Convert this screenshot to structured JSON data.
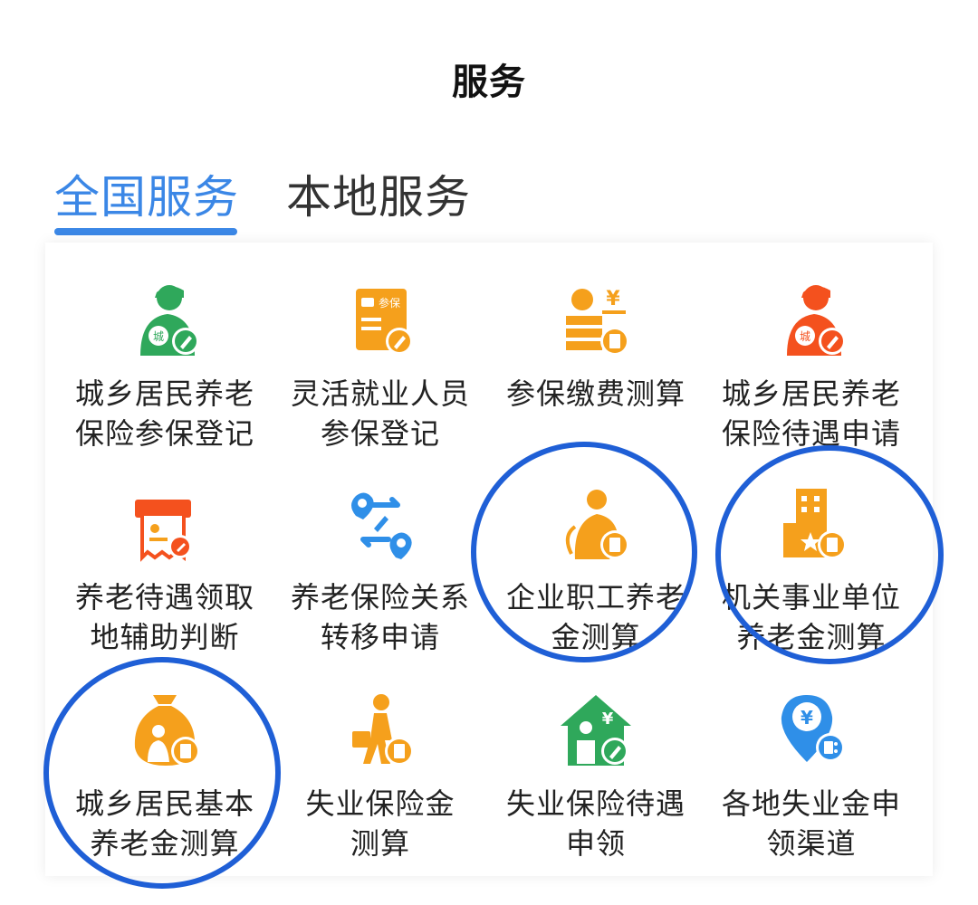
{
  "header": {
    "title": "服务"
  },
  "tabs": [
    {
      "label": "全国服务",
      "active": true
    },
    {
      "label": "本地服务",
      "active": false
    }
  ],
  "colors": {
    "accent": "#3b87e6",
    "highlight_circle": "#1f5fd6",
    "green": "#2fa85b",
    "orange": "#f5a01c",
    "red_orange": "#f4511e",
    "blue": "#2f8fe8"
  },
  "services": [
    {
      "label": "城乡居民养老\n保险参保登记",
      "icon": "rural-pension-register-icon"
    },
    {
      "label": "灵活就业人员\n参保登记",
      "icon": "flexible-employment-register-icon"
    },
    {
      "label": "参保缴费测算",
      "icon": "contribution-calculation-icon"
    },
    {
      "label": "城乡居民养老\n保险待遇申请",
      "icon": "rural-pension-benefit-apply-icon"
    },
    {
      "label": "养老待遇领取\n地辅助判断",
      "icon": "pension-collection-place-icon"
    },
    {
      "label": "养老保险关系\n转移申请",
      "icon": "pension-transfer-icon"
    },
    {
      "label": "企业职工养老\n金测算",
      "icon": "enterprise-pension-calc-icon"
    },
    {
      "label": "机关事业单位\n养老金测算",
      "icon": "institution-pension-calc-icon"
    },
    {
      "label": "城乡居民基本\n养老金测算",
      "icon": "rural-basic-pension-calc-icon"
    },
    {
      "label": "失业保险金\n测算",
      "icon": "unemployment-benefit-calc-icon"
    },
    {
      "label": "失业保险待遇\n申领",
      "icon": "unemployment-benefit-claim-icon"
    },
    {
      "label": "各地失业金申\n领渠道",
      "icon": "unemployment-channels-icon"
    }
  ],
  "icon_text": {
    "cheng": "城",
    "canbao": "参保",
    "yen": "¥"
  }
}
